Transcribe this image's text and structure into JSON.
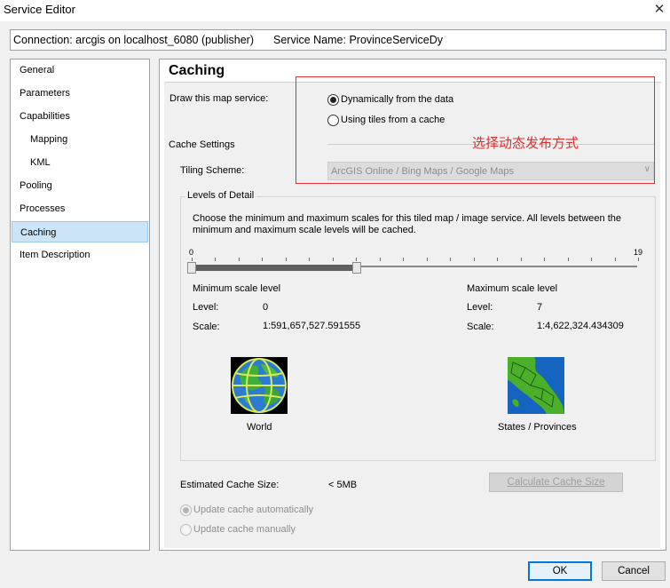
{
  "window": {
    "title": "Service Editor",
    "close_glyph": "✕"
  },
  "connection": {
    "connection_text": "Connection: arcgis on localhost_6080 (publisher)",
    "service_name_text": "Service Name: ProvinceServiceDy"
  },
  "nav": {
    "items": [
      {
        "label": "General"
      },
      {
        "label": "Parameters"
      },
      {
        "label": "Capabilities"
      },
      {
        "label": "Mapping"
      },
      {
        "label": "KML"
      },
      {
        "label": "Pooling"
      },
      {
        "label": "Processes"
      },
      {
        "label": "Caching"
      },
      {
        "label": "Item Description"
      }
    ],
    "selected": "Caching"
  },
  "caching": {
    "heading": "Caching",
    "draw_label": "Draw this map service:",
    "option_dynamic": "Dynamically from the data",
    "option_tiles": "Using tiles from a cache",
    "selected_option": "dynamic",
    "cache_settings_label": "Cache Settings",
    "tiling_scheme_label": "Tiling Scheme:",
    "tiling_scheme_value": "ArcGIS Online / Bing Maps / Google Maps",
    "annotation": "选择动态发布方式",
    "levels": {
      "legend": "Levels of Detail",
      "description": "Choose the minimum and maximum scales for this tiled map / image service. All levels between the minimum and maximum scale levels will be cached.",
      "slider_min_label": "0",
      "slider_max_label": "19",
      "slider_min": 0,
      "slider_max": 19,
      "range_low": 0,
      "range_high": 7,
      "min_title": "Minimum scale level",
      "min_level_label": "Level:",
      "min_level_value": "0",
      "min_scale_label": "Scale:",
      "min_scale_value": "1:591,657,527.591555",
      "max_title": "Maximum scale level",
      "max_level_label": "Level:",
      "max_level_value": "7",
      "max_scale_label": "Scale:",
      "max_scale_value": "1:4,622,324.434309",
      "world_caption": "World",
      "states_caption": "States / Provinces"
    },
    "estimated_label": "Estimated Cache Size:",
    "estimated_value": "< 5MB",
    "calculate_button": "Calculate Cache Size",
    "update_auto": "Update cache automatically",
    "update_manual": "Update cache manually"
  },
  "buttons": {
    "ok": "OK",
    "cancel": "Cancel"
  },
  "colors": {
    "annotation_red": "#e03030",
    "selection_blue": "#cce4f7",
    "focus_blue": "#0078d7"
  }
}
